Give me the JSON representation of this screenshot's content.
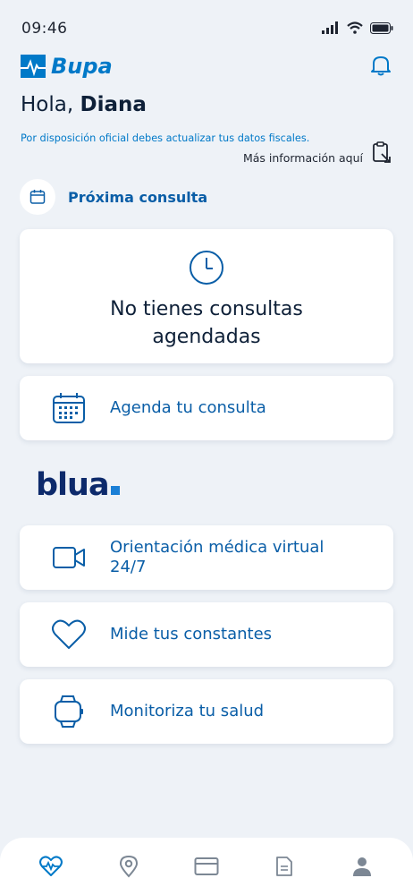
{
  "status": {
    "time": "09:46"
  },
  "header": {
    "brand": "Bupa"
  },
  "greeting": {
    "prefix": "Hola,",
    "name": "Diana"
  },
  "notice": {
    "text": "Por disposición oficial debes actualizar tus datos fiscales.",
    "link": "Más información aquí"
  },
  "next_appointment": {
    "label": "Próxima consulta"
  },
  "empty_state": {
    "line1": "No tienes consultas",
    "line2": "agendadas"
  },
  "actions": {
    "book": "Agenda tu consulta",
    "virtual_line1": "Orientación médica virtual",
    "virtual_line2": "24/7",
    "vitals": "Mide tus constantes",
    "monitor": "Monitoriza tu salud"
  },
  "partner": {
    "brand": "blua"
  },
  "colors": {
    "accent": "#0079c8",
    "text_dark": "#0e2038",
    "background": "#eef2f7"
  },
  "nav": {
    "items": [
      "heart-pulse-icon",
      "location-pin-icon",
      "card-icon",
      "document-icon",
      "profile-icon"
    ],
    "active": "heart-pulse-icon"
  }
}
